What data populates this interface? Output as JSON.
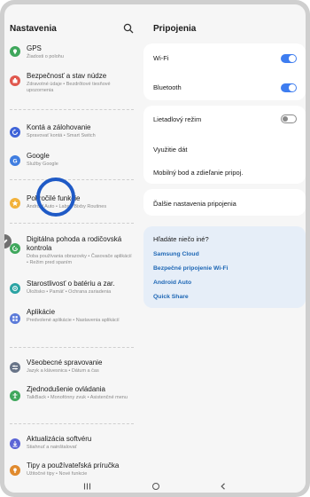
{
  "left_pane": {
    "title": "Nastavenia",
    "items": [
      {
        "title": "GPS",
        "subtitle": "Žiadosti o polohu",
        "icon": "location-icon",
        "color": "#3fa75c"
      },
      {
        "title": "Bezpečnosť a stav núdze",
        "subtitle": "Zdravotné údaje • Bezdrôtové tiesňové upozornenia",
        "icon": "emergency-icon",
        "color": "#e0584e"
      },
      {
        "title": "Kontá a zálohovanie",
        "subtitle": "Spravovať kontá • Smart Switch",
        "icon": "sync-icon",
        "color": "#3e63d8"
      },
      {
        "title": "Google",
        "subtitle": "Služby Google",
        "icon": "google-icon",
        "color": "#3f7de0"
      },
      {
        "title": "Pokročilé funkcie",
        "subtitle": "Android Auto • Labs • Bixby Routines",
        "icon": "star-icon",
        "color": "#f2b23b"
      },
      {
        "title": "Digitálna pohoda a rodičovská kontrola",
        "subtitle": "Doba používania obrazovky • Časovače aplikácií • Režim pred spaním",
        "icon": "wellbeing-icon",
        "color": "#3fa75c"
      },
      {
        "title": "Starostlivosť o batériu a zar.",
        "subtitle": "Úložisko • Pamäť • Ochrana zariadenia",
        "icon": "device-care-icon",
        "color": "#2aa3a3"
      },
      {
        "title": "Aplikácie",
        "subtitle": "Predvolené aplikácie • Nastavenia aplikácií",
        "icon": "apps-icon",
        "color": "#5b7ad9"
      },
      {
        "title": "Všeobecné spravovanie",
        "subtitle": "Jazyk a klávesnica • Dátum a čas",
        "icon": "sliders-icon",
        "color": "#687488"
      },
      {
        "title": "Zjednodušenie ovládania",
        "subtitle": "TalkBack • Monofónny zvuk • Asistenčné menu",
        "icon": "accessibility-icon",
        "color": "#3fa75c"
      },
      {
        "title": "Aktualizácia softvéru",
        "subtitle": "Stiahnuť a nainštalovať",
        "icon": "update-icon",
        "color": "#5b64d6"
      },
      {
        "title": "Tipy a používateľská príručka",
        "subtitle": "Užitočné tipy • Nové funkcie",
        "icon": "tips-icon",
        "color": "#e08a2e"
      }
    ]
  },
  "right_pane": {
    "title": "Pripojenia",
    "toggles": [
      {
        "label": "Wi-Fi",
        "on": true
      },
      {
        "label": "Bluetooth",
        "on": true
      },
      {
        "label": "Lietadlový režim",
        "on": false
      }
    ],
    "rows": [
      {
        "label": "Využitie dát"
      },
      {
        "label": "Mobilný bod a zdieľanie pripoj."
      },
      {
        "label": "Ďalšie nastavenia pripojenia"
      }
    ],
    "help": {
      "title": "Hľadáte niečo iné?",
      "links": [
        "Samsung Cloud",
        "Bezpečné pripojenie Wi-Fi",
        "Android Auto",
        "Quick Share"
      ]
    }
  },
  "colors": {
    "accent": "#3e7df0",
    "link": "#1e67b5",
    "cursor": "#1f5ac6"
  }
}
